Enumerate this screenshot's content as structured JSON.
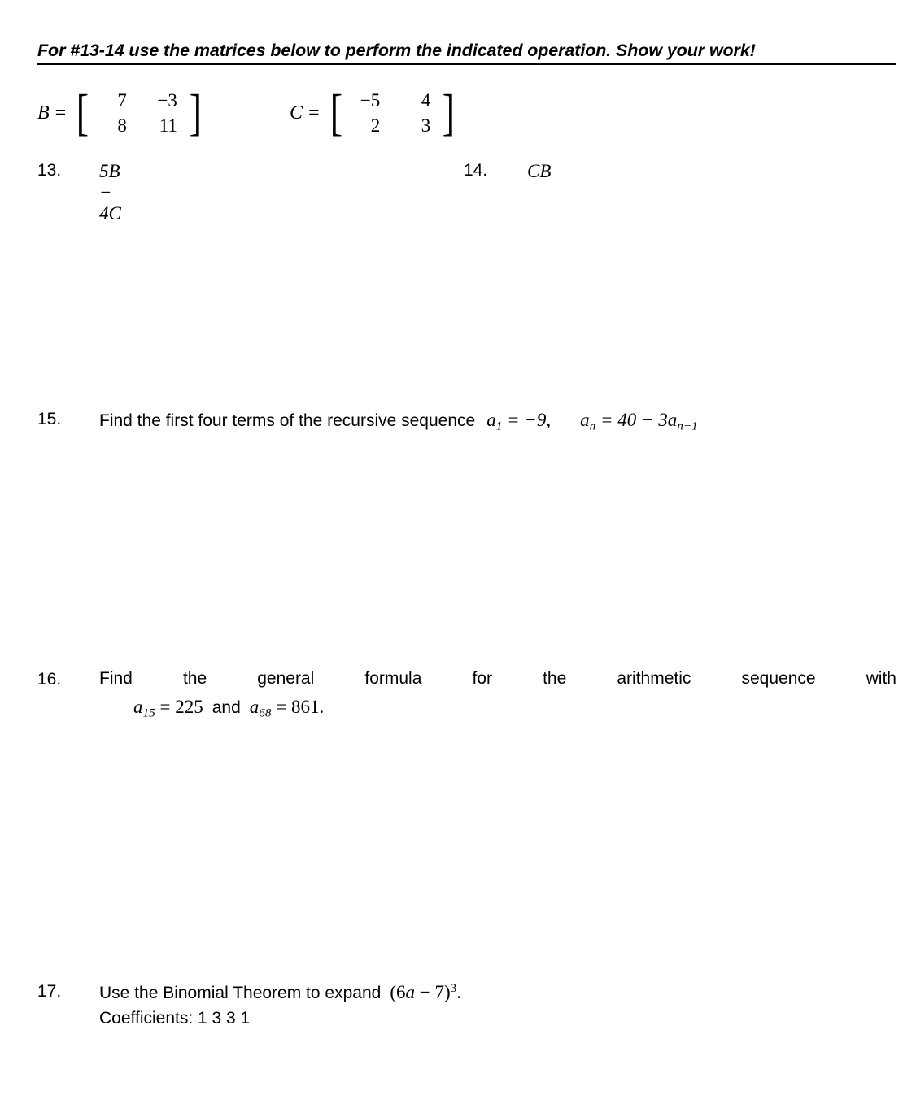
{
  "page": {
    "background": "#ffffff",
    "text_color": "#000000"
  },
  "header": {
    "instruction": "For #13-14 use the matrices below to perform the indicated operation.  Show your work!"
  },
  "matrices": [
    {
      "name": "B",
      "equals": "=",
      "open_bracket": "[",
      "close_bracket": "]",
      "rows": [
        [
          "7",
          "−3"
        ],
        [
          "8",
          "11"
        ]
      ]
    },
    {
      "name": "C",
      "equals": "=",
      "open_bracket": "[",
      "close_bracket": "]",
      "rows": [
        [
          "−5",
          "4"
        ],
        [
          "2",
          "3"
        ]
      ]
    }
  ],
  "problems": [
    {
      "number": "13.",
      "expression": "5B − 4C"
    },
    {
      "number": "14.",
      "expression": "CB"
    },
    {
      "number": "15.",
      "text": "Find the first four terms of the recursive sequence",
      "given_first_term": "a₁ = −9,",
      "given_recursion": "aₙ = 40 − 3aₙ₋₁",
      "term_var": "a",
      "term_sub_1": "1",
      "term_val_1": "= −9,",
      "rec_var": "a",
      "rec_sub": "n",
      "rec_val": "= 40 − 3",
      "rec_var2": "a",
      "rec_sub2": "n−1"
    },
    {
      "number": "16.",
      "line1": "Find the general formula for the arithmetic sequence with",
      "line2_prefix": "a",
      "line2_sub1": "15",
      "line2_mid": "= 225",
      "line2_and": "and",
      "line2_prefix2": "a",
      "line2_sub2": "68",
      "line2_end": "= 861."
    },
    {
      "number": "17.",
      "line1_text": "Use the Binomial Theorem to expand",
      "line1_expr_open": "(6",
      "line1_expr_var": "a",
      "line1_expr_mid": " − 7)",
      "line1_expr_exp": "3",
      "line1_expr_period": ".",
      "line2": "Coefficients:  1  3   3  1"
    }
  ]
}
